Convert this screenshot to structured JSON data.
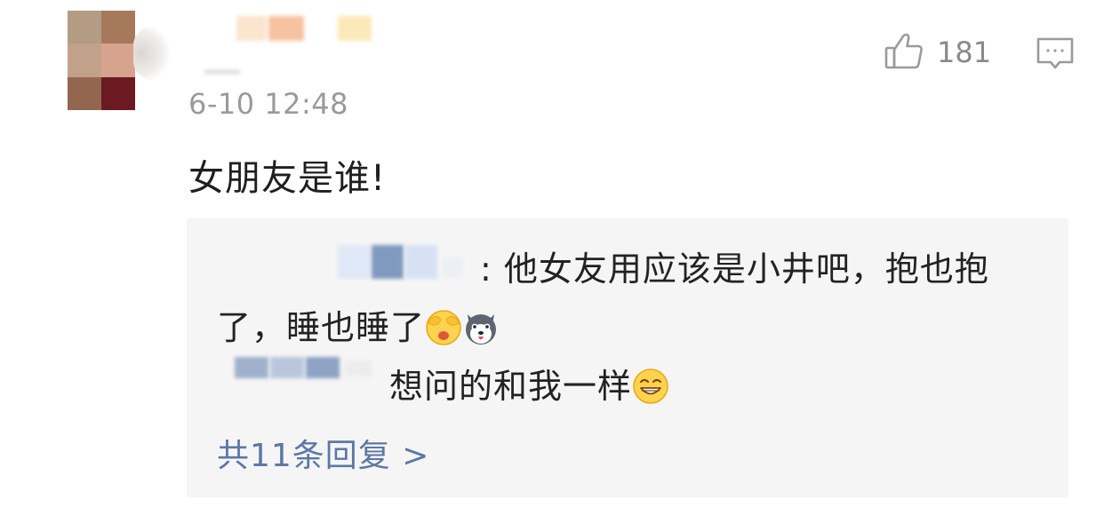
{
  "comment": {
    "timestamp": "6-10 12:48",
    "text": "女朋友是谁!",
    "like_count": "181"
  },
  "icons": {
    "like": "thumbs-up-icon",
    "reply": "comment-bubble-icon"
  },
  "replies": [
    {
      "text_line1": ": 他女友用应该是小井吧，抱也抱",
      "text_line2": "了，睡也睡了",
      "emojis": [
        "shy-cover-face-emoji",
        "husky-dog-emoji"
      ]
    },
    {
      "text": "想问的和我一样",
      "emojis": [
        "grin-emoji"
      ]
    }
  ],
  "more_replies": {
    "label": "共11条回复 >"
  },
  "colors": {
    "link": "#5b78a6",
    "timestamp": "#9a9a9a",
    "reply_bg": "#f5f5f5"
  }
}
